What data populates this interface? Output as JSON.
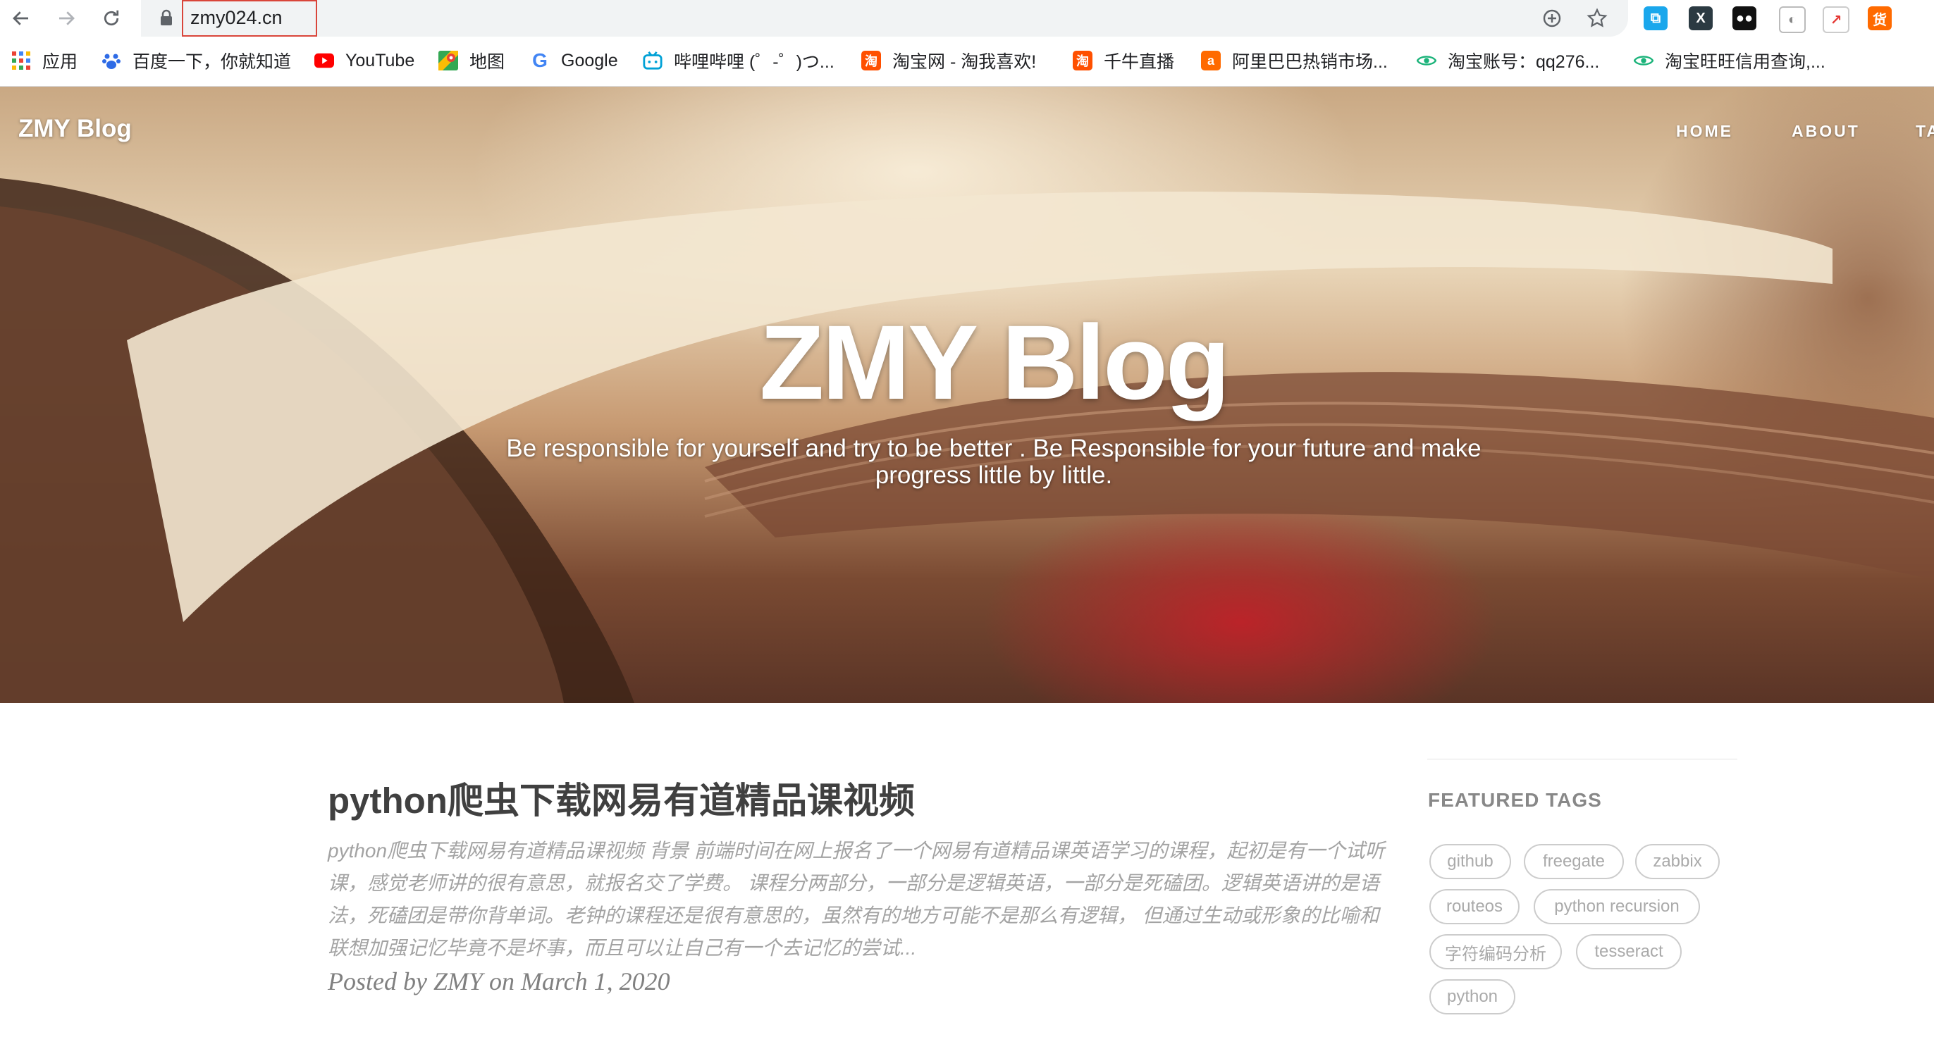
{
  "browser": {
    "url": "zmy024.cn",
    "bookmarks": [
      {
        "label": "应用",
        "icon": "apps-grid-icon"
      },
      {
        "label": "百度一下，你就知道",
        "icon": "baidu-paw-icon"
      },
      {
        "label": "YouTube",
        "icon": "youtube-icon"
      },
      {
        "label": "地图",
        "icon": "maps-icon"
      },
      {
        "label": "Google",
        "icon": "google-icon"
      },
      {
        "label": "哔哩哔哩 (゜-゜)つ...",
        "icon": "bilibili-icon"
      },
      {
        "label": "淘宝网 - 淘我喜欢!",
        "icon": "taobao-icon"
      },
      {
        "label": "千牛直播",
        "icon": "taobao-icon"
      },
      {
        "label": "阿里巴巴热销市场...",
        "icon": "alibaba-icon"
      },
      {
        "label": "淘宝账号：qq276...",
        "icon": "eye-icon"
      },
      {
        "label": "淘宝旺旺信用查询,...",
        "icon": "eye-icon"
      }
    ],
    "extension_labels": {
      "x": "X",
      "huo": "货"
    }
  },
  "site": {
    "brand": "ZMY Blog",
    "nav": [
      "HOME",
      "ABOUT",
      "TA"
    ],
    "hero_title": "ZMY Blog",
    "hero_subtitle": "Be responsible for yourself and try to be better . Be Responsible for your future and make progress little by little."
  },
  "post": {
    "title": "python爬虫下载网易有道精品课视频",
    "excerpt": "python爬虫下载网易有道精品课视频 背景 前端时间在网上报名了一个网易有道精品课英语学习的课程，起初是有一个试听课，感觉老师讲的很有意思，就报名交了学费。 课程分两部分，一部分是逻辑英语，一部分是死磕团。逻辑英语讲的是语法，死磕团是带你背单词。老钟的课程还是很有意思的，虽然有的地方可能不是那么有逻辑， 但通过生动或形象的比喻和联想加强记忆毕竟不是坏事，而且可以让自己有一个去记忆的尝试...",
    "meta": "Posted by ZMY on March 1, 2020"
  },
  "sidebar": {
    "heading": "FEATURED TAGS",
    "tags": [
      "github",
      "freegate",
      "zabbix",
      "routeos",
      "python recursion",
      "字符编码分析",
      "tesseract",
      "python"
    ]
  },
  "colors": {
    "url_highlight": "#d9453a",
    "omnibox": "#f1f3f4",
    "tag_border": "#cccccc",
    "title_text": "#404040"
  }
}
